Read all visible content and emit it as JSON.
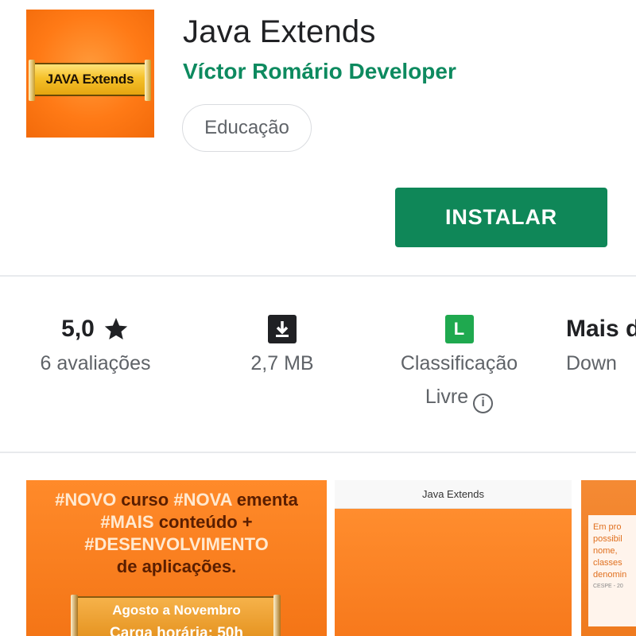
{
  "app": {
    "title": "Java Extends",
    "developer": "Víctor Romário Developer",
    "category": "Educação",
    "icon_text": "JAVA Extends"
  },
  "install": {
    "label": "INSTALAR",
    "color": "#0f8758"
  },
  "stats": {
    "rating": {
      "value": "5,0",
      "sub": "6 avaliações",
      "icon": "star-icon"
    },
    "size": {
      "sub": "2,7 MB",
      "icon": "download-icon"
    },
    "content_rating": {
      "badge": "L",
      "sub1": "Classificação",
      "sub2": "Livre",
      "icon": "info-icon",
      "badge_color": "#1fa94f"
    },
    "downloads": {
      "value": "Mais d",
      "sub": "Down"
    }
  },
  "screenshots": {
    "first": {
      "line1_a": "#NOVO",
      "line1_b": " curso ",
      "line1_c": "#NOVA",
      "line1_d": " ementa",
      "line2_a": "#MAIS",
      "line2_b": " conteúdo +",
      "line3": "#DESENVOLVIMENTO",
      "line4": "de aplicações.",
      "plate_line1": "Agosto a Novembro",
      "plate_line2": "Carga horária: 50h"
    },
    "second": {
      "title": "Java Extends"
    },
    "third": {
      "lines": [
        "Em pro",
        "possibil",
        "nome, ",
        "classes ",
        "denomin"
      ],
      "small": "CESPE - 20"
    }
  },
  "colors": {
    "accent_green": "#0d8a5f",
    "orange": "#f47516"
  }
}
